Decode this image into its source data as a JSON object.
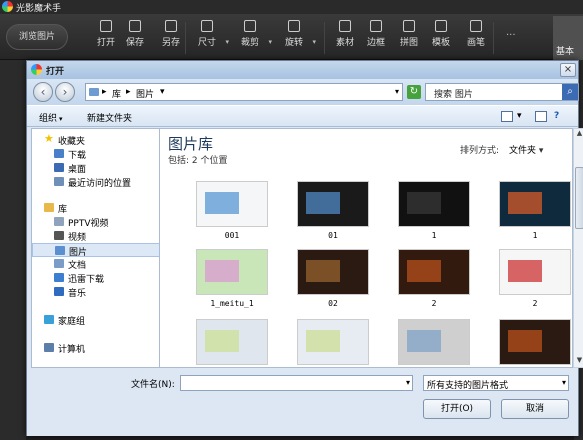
{
  "app": {
    "title": "光影魔术手",
    "browse_button": "浏览图片",
    "tools": [
      {
        "label": "打开",
        "icon": "open-icon"
      },
      {
        "label": "保存",
        "icon": "save-icon"
      },
      {
        "label": "另存",
        "icon": "save-as-icon"
      },
      {
        "label": "尺寸",
        "icon": "resize-icon"
      },
      {
        "label": "裁剪",
        "icon": "crop-icon"
      },
      {
        "label": "旋转",
        "icon": "rotate-icon"
      },
      {
        "label": "素材",
        "icon": "star-icon"
      },
      {
        "label": "边框",
        "icon": "frame-icon"
      },
      {
        "label": "拼图",
        "icon": "grid-icon"
      },
      {
        "label": "模板",
        "icon": "template-icon"
      },
      {
        "label": "画笔",
        "icon": "brush-icon"
      }
    ],
    "more": "···",
    "tab_basic": "基本"
  },
  "dialog": {
    "title": "打开",
    "close": "×",
    "address": {
      "seg1": "库",
      "seg2": "图片"
    },
    "search_placeholder": "搜索 图片",
    "cmd": {
      "organize": "组织",
      "new_folder": "新建文件夹"
    },
    "sidebar": [
      {
        "label": "收藏夹",
        "icon": "star-icon",
        "indent": 0,
        "color": "#f2c200"
      },
      {
        "label": "下载",
        "icon": "download-icon",
        "indent": 1,
        "color": "#4a80c8"
      },
      {
        "label": "桌面",
        "icon": "desktop-icon",
        "indent": 1,
        "color": "#3a6bb3"
      },
      {
        "label": "最近访问的位置",
        "icon": "recent-places-icon",
        "indent": 1,
        "color": "#6d8fb8"
      },
      {
        "label": "库",
        "icon": "library-icon",
        "indent": 0,
        "color": "#e8b84a"
      },
      {
        "label": "PPTV视频",
        "icon": "folder-icon",
        "indent": 1,
        "color": "#8fa3bd"
      },
      {
        "label": "视频",
        "icon": "video-icon",
        "indent": 1,
        "color": "#555"
      },
      {
        "label": "图片",
        "icon": "pictures-icon",
        "indent": 1,
        "color": "#5b8fd0",
        "selected": true
      },
      {
        "label": "文档",
        "icon": "documents-icon",
        "indent": 1,
        "color": "#7a9cc6"
      },
      {
        "label": "迅雷下载",
        "icon": "thunder-icon",
        "indent": 1,
        "color": "#3c7ed0"
      },
      {
        "label": "音乐",
        "icon": "music-icon",
        "indent": 1,
        "color": "#2f6bbf"
      },
      {
        "label": "家庭组",
        "icon": "homegroup-icon",
        "indent": 0,
        "color": "#3aa0d8"
      },
      {
        "label": "计算机",
        "icon": "computer-icon",
        "indent": 0,
        "color": "#5b7fa8"
      }
    ],
    "library_title": "图片库",
    "library_sub": "包括: 2 个位置",
    "arrange_label": "排列方式:",
    "arrange_value": "文件夹",
    "thumbs": [
      {
        "label": "001",
        "bg": "#f4f6f8",
        "accent": "#6aa3d8"
      },
      {
        "label": "01",
        "bg": "#1a1a1a",
        "accent": "#4a7bb0"
      },
      {
        "label": "1",
        "bg": "#111111",
        "accent": "#333"
      },
      {
        "label": "1",
        "bg": "#0f2a3d",
        "accent": "#c0552b"
      },
      {
        "label": "1_meitu_1",
        "bg": "#c9e6b8",
        "accent": "#d8a3cf"
      },
      {
        "label": "02",
        "bg": "#2a1a12",
        "accent": "#8a5a2a"
      },
      {
        "label": "2",
        "bg": "#331a0f",
        "accent": "#a84a1a"
      },
      {
        "label": "2",
        "bg": "#f6f6f6",
        "accent": "#d04a4a"
      },
      {
        "label": "",
        "bg": "#dfe6ee",
        "accent": "#cfe0a0"
      },
      {
        "label": "",
        "bg": "#e6ecf2",
        "accent": "#cfe0a0"
      },
      {
        "label": "",
        "bg": "#cfcfcf",
        "accent": "#8aa8c8"
      },
      {
        "label": "",
        "bg": "#2a1a12",
        "accent": "#a84a1a"
      }
    ],
    "filename_label": "文件名(N):",
    "filename_value": "",
    "filter_value": "所有支持的图片格式",
    "open_button": "打开(O)",
    "cancel_button": "取消"
  }
}
